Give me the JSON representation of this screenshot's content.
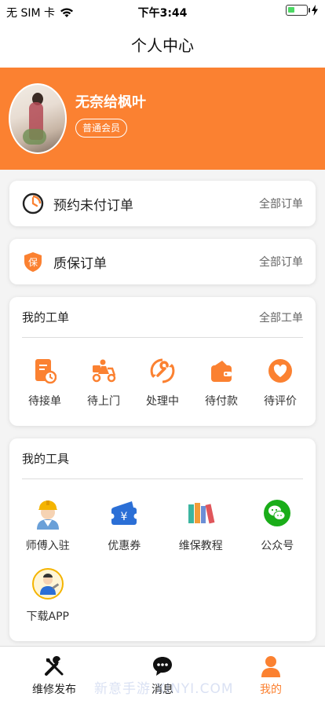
{
  "status_bar": {
    "carrier": "无 SIM 卡",
    "time": "下午3:44"
  },
  "nav": {
    "title": "个人中心"
  },
  "profile": {
    "username": "无奈给枫叶",
    "member_level": "普通会员"
  },
  "orders": [
    {
      "title": "预约未付订单",
      "link": "全部订单",
      "icon": "clock-icon"
    },
    {
      "title": "质保订单",
      "link": "全部订单",
      "icon": "warranty-shield-icon"
    }
  ],
  "work_orders": {
    "title": "我的工单",
    "link": "全部工单",
    "items": [
      {
        "label": "待接单",
        "icon": "pending-accept-icon"
      },
      {
        "label": "待上门",
        "icon": "delivery-scooter-icon"
      },
      {
        "label": "处理中",
        "icon": "repair-wrench-icon"
      },
      {
        "label": "待付款",
        "icon": "wallet-icon"
      },
      {
        "label": "待评价",
        "icon": "heart-icon"
      }
    ]
  },
  "tools": {
    "title": "我的工具",
    "items": [
      {
        "label": "师傅入驻",
        "icon": "worker-avatar-icon"
      },
      {
        "label": "优惠券",
        "icon": "coupon-icon"
      },
      {
        "label": "维保教程",
        "icon": "books-icon"
      },
      {
        "label": "公众号",
        "icon": "wechat-icon"
      },
      {
        "label": "下载APP",
        "icon": "app-mascot-icon"
      }
    ]
  },
  "tabbar": {
    "items": [
      {
        "label": "维修发布",
        "icon": "tools-icon",
        "active": false
      },
      {
        "label": "消息",
        "icon": "chat-bubble-icon",
        "active": false
      },
      {
        "label": "我的",
        "icon": "person-icon",
        "active": true
      }
    ]
  },
  "watermark": "新意手游 XINYI.COM",
  "colors": {
    "accent": "#fb8131",
    "wechat_green": "#1aad19"
  }
}
